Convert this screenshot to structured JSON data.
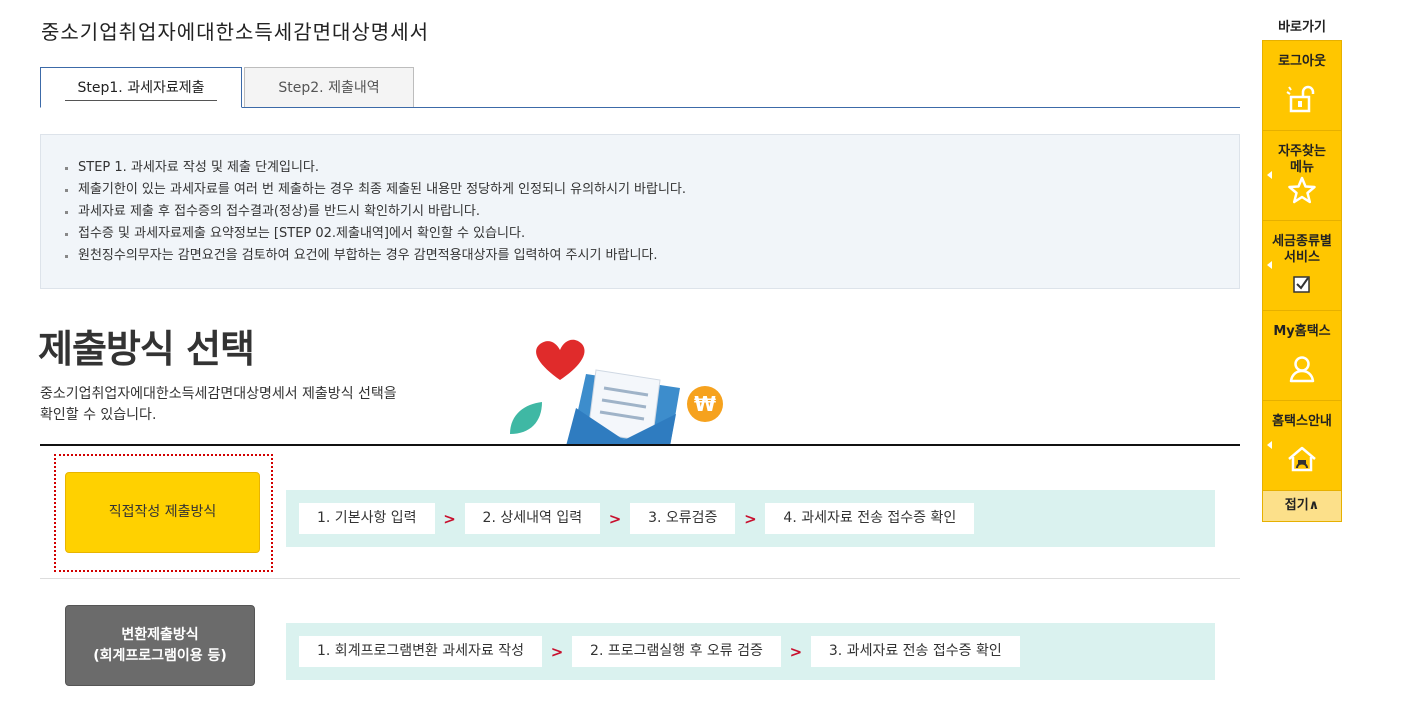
{
  "page": {
    "title": "중소기업취업자에대한소득세감면대상명세서"
  },
  "tabs": [
    {
      "label": "Step1. 과세자료제출",
      "active": true
    },
    {
      "label": "Step2. 제출내역",
      "active": false
    }
  ],
  "notices": [
    "STEP 1. 과세자료 작성 및 제출 단계입니다.",
    "제출기한이 있는 과세자료를 여러 번 제출하는 경우 최종 제출된 내용만 정당하게 인정되니 유의하시기 바랍니다.",
    "과세자료 제출 후 접수증의 접수결과(정상)를 반드시 확인하기시 바랍니다.",
    "접수증 및 과세자료제출 요약정보는 [STEP 02.제출내역]에서 확인할 수 있습니다.",
    "원천징수의무자는 감면요건을 검토하여 요건에 부합하는 경우 감면적용대상자를 입력하여 주시기 바랍니다."
  ],
  "section": {
    "title": "제출방식 선택",
    "desc_line1": "중소기업취업자에대한소득세감면대상명세서 제출방식 선택을",
    "desc_line2": "확인할 수 있습니다."
  },
  "methods": {
    "direct": {
      "label": "직접작성 제출방식",
      "steps": [
        "1. 기본사항 입력",
        "2. 상세내역 입력",
        "3. 오류검증",
        "4. 과세자료 전송 접수증 확인"
      ]
    },
    "convert": {
      "label_line1": "변환제출방식",
      "label_line2": "(회계프로그램이용 등)",
      "steps": [
        "1. 회계프로그램변환 과세자료 작성",
        "2. 프로그램실행 후 오류 검증",
        "3. 과세자료 전송 접수증 확인"
      ]
    },
    "arrow": ">"
  },
  "quick_menu": {
    "title": "바로가기",
    "items": [
      {
        "label1": "로그아웃",
        "label2": "",
        "icon": "unlock-icon"
      },
      {
        "label1": "자주찾는",
        "label2": "메뉴",
        "icon": "star-icon"
      },
      {
        "label1": "세금종류별",
        "label2": "서비스",
        "icon": "checkbox-icon"
      },
      {
        "label1": "My홈택스",
        "label2": "",
        "icon": "person-icon"
      },
      {
        "label1": "홈택스안내",
        "label2": "",
        "icon": "home-icon"
      }
    ],
    "close_label": "접기∧"
  },
  "colors": {
    "accent_yellow": "#ffd100",
    "quick_yellow": "#ffc600",
    "flow_bg": "#daf2ef",
    "arrow_red": "#c8102e",
    "tab_blue": "#3c6aa8"
  }
}
